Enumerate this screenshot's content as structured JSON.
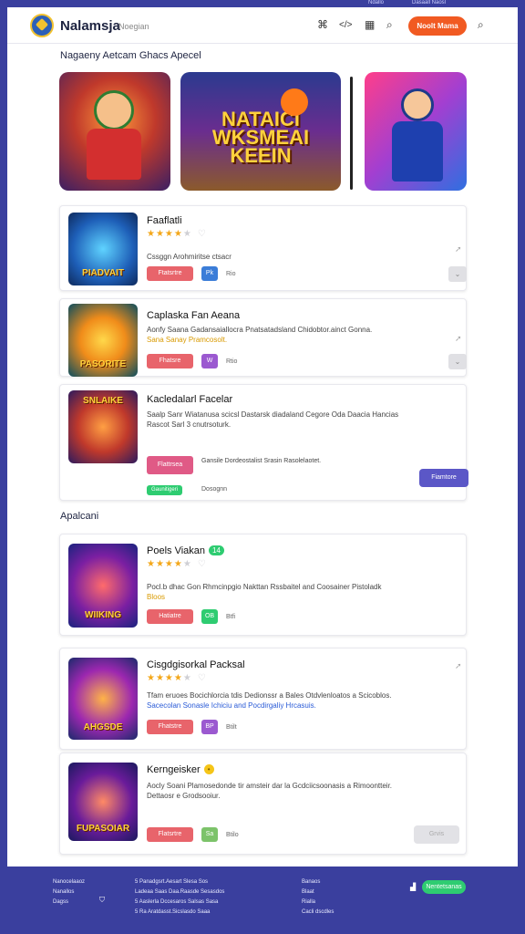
{
  "header": {
    "brand": "Nalamsja",
    "brand_sub": "Noegian",
    "icons": [
      "puzzle-icon",
      "code-icon",
      "grid-icon",
      "search-icon"
    ],
    "cta_label": "Noolt Mama",
    "extra_icon": "search-icon"
  },
  "top_links": [
    "Ndallo",
    "Dasaall Naosl"
  ],
  "hero_section": {
    "title": "Nagaeny Aetcam Ghacs Apecel",
    "slides": [
      {
        "label": ""
      },
      {
        "label": "NATAICI WKSMEAI KEEIN"
      },
      {
        "label": ""
      }
    ]
  },
  "featured": [
    {
      "title": "Faaflatli",
      "badge": "",
      "rating": 3.5,
      "description": [
        "Cssggn Arohmiritse ctsacr"
      ],
      "button": "Ftatsrtre",
      "square": "Pk",
      "meta": "Rio",
      "thumb_label": "PIADVAIT"
    },
    {
      "title": "Caplaska Fan Aeana",
      "badge": "",
      "rating": null,
      "description": [
        "Aonfy Saana Gadansaiallocra Pnatsatadsland Chidobtor.ainct Gonna.",
        "Sana Sanay Pramcosolt."
      ],
      "button": "Fhatsre",
      "square": "W",
      "meta": "Rtio",
      "thumb_label": "PASORITE"
    },
    {
      "title": "Kacledalarl Facelar",
      "badge": "",
      "rating": null,
      "description": [
        "Saalp Sanr Wiatanusa scicsl Dastarsk diadaland Cegore Oda Daacia Hancias",
        "Rascot Sarl 3 cnutrsoturk."
      ],
      "button": "Flattrsea",
      "secondary_text": "Gansile Dordeostalist Srasin Rasolelaotet.",
      "action_button": "Fiamtore",
      "tags": [
        "Gaunitigeri",
        "Dosognn"
      ],
      "thumb_label": "SNLAIKE"
    }
  ],
  "list_section": {
    "title": "Apalcani",
    "items": [
      {
        "title": "Poels Viakan",
        "badge": "14",
        "rating": 3.5,
        "description": [
          "Pocl.b dhac Gon Rhmcinpgio Nakttan Rssbaitel and Coosainer Pistoladk",
          "Bloos"
        ],
        "button": "Hatiatre",
        "square": "OB",
        "meta": "Btfi",
        "thumb_label": "WIIKING"
      },
      {
        "title": "Cisgdgisorkal Packsal",
        "badge": "",
        "rating": 3.5,
        "description": [
          "Tfam eruoes Bocichlorcia tdis Dedionssr a Bales Otdvlenloatos a Scicoblos.",
          "Sacecolan Sonasle Ichiciu and Pocdirgaliy Hrcasuis."
        ],
        "button": "Fhatstre",
        "square": "BP",
        "meta": "Btilt",
        "thumb_label": "AHGSDE"
      },
      {
        "title": "Kerngeisker",
        "badge": "•",
        "rating": null,
        "description": [
          "Aocly Soani Plamosedonde tir amsteir dar la Gcdciicsoonasis a Rimoontteir.",
          "Dettaosr e Grodsooiur."
        ],
        "button": "Flatsrtre",
        "square": "Sa",
        "meta": "Btilo",
        "action_button": "Grvis",
        "thumb_label": "FUPASOIAR"
      }
    ]
  },
  "footer": {
    "col1": [
      "Nanocelaaoz",
      "Nanallos",
      "Dagss"
    ],
    "col2": [
      "5 Panadgsrt.Aesart Slesa Sos",
      "Ladeaa Saas Daa.Raasde Sesasdos",
      "5 Aaslerla Dccesaros Salsas Sasa",
      "5 Ra Aratdasst.Sicslasdo Saaa"
    ],
    "col3": [
      "Banaos",
      "Blaat",
      "Rialla",
      "Cacli dscdles"
    ],
    "button": "Nentetsanas"
  },
  "colors": {
    "brand": "#3a3f9e",
    "accent": "#f15a22",
    "action": "#e8646b",
    "star": "#f3a71a"
  }
}
